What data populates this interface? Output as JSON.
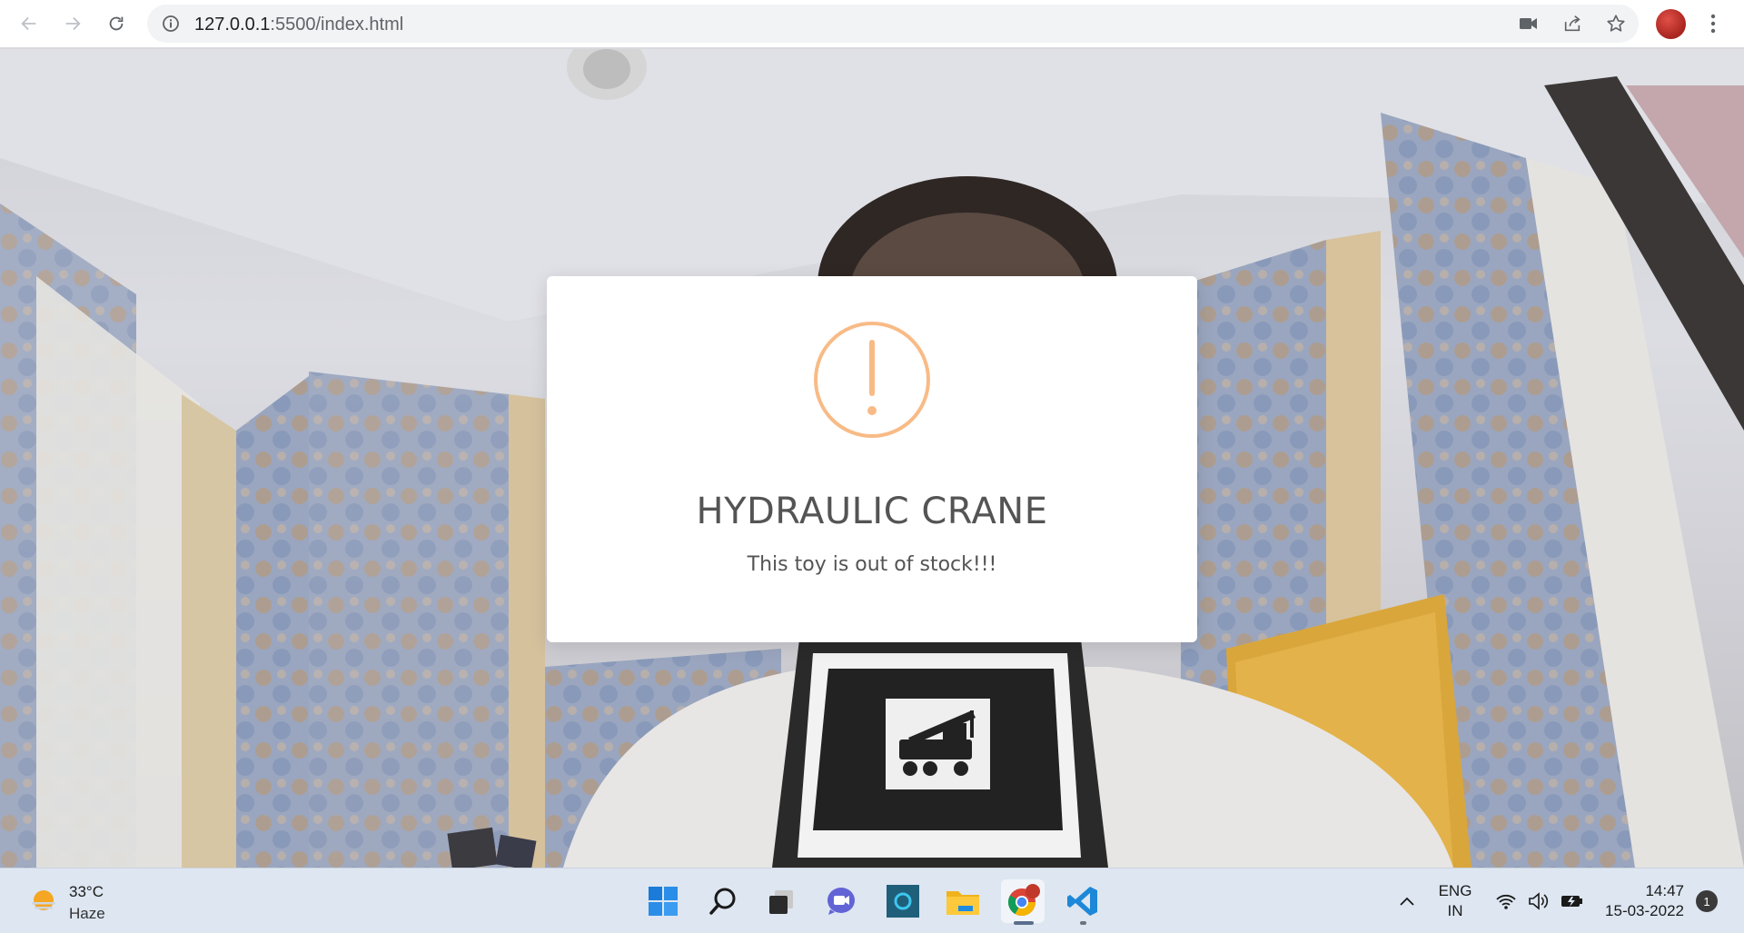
{
  "browser": {
    "url_host": "127.0.0.1",
    "url_path": ":5500/index.html"
  },
  "modal": {
    "title": "HYDRAULIC CRANE",
    "message": "This toy is out of stock!!!",
    "icon": "exclamation-circle-icon",
    "icon_color": "#f8bb86"
  },
  "taskbar": {
    "weather": {
      "temp": "33°C",
      "desc": "Haze"
    },
    "apps": [
      "windows-start-icon",
      "search-icon",
      "task-view-icon",
      "teams-chat-icon",
      "cortana-icon",
      "file-explorer-icon",
      "chrome-icon",
      "vscode-icon"
    ],
    "language": {
      "line1": "ENG",
      "line2": "IN"
    },
    "clock": {
      "time": "14:47",
      "date": "15-03-2022"
    },
    "notification_count": "1"
  }
}
